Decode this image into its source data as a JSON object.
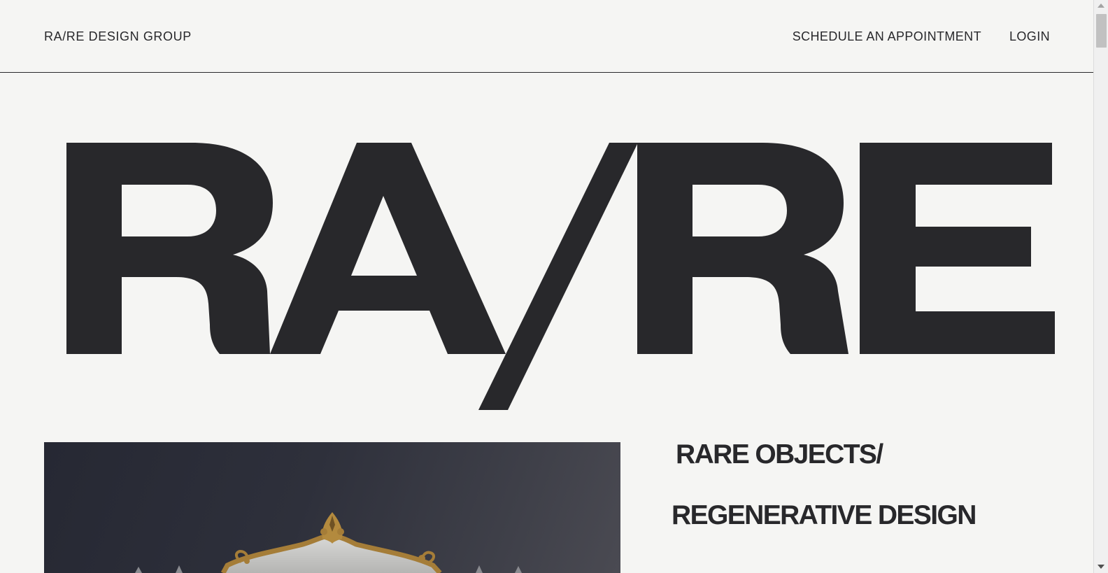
{
  "header": {
    "brand": "RA/RE DESIGN GROUP",
    "nav": {
      "appointment": "SCHEDULE AN APPOINTMENT",
      "login": "LOGIN"
    }
  },
  "hero": {
    "logo_text": "RA/RE"
  },
  "feature": {
    "image_subject": "ornate gilded mirror on dark wall"
  },
  "taglines": {
    "line1": "RARE OBJECTS/",
    "line2": "REGENERATIVE DESIGN"
  },
  "colors": {
    "background": "#f5f5f3",
    "ink": "#28282b",
    "image_dark": "#262833",
    "gold": "#b38a3e"
  }
}
